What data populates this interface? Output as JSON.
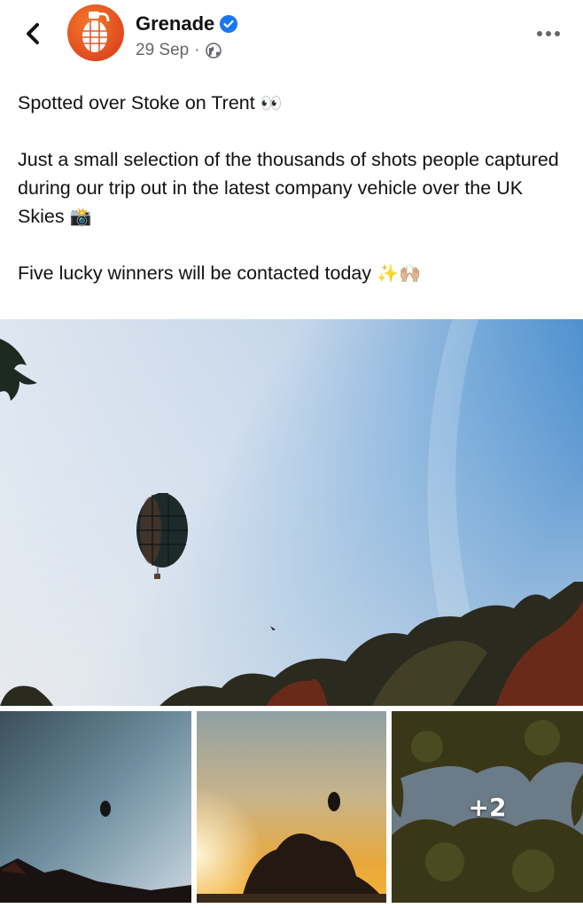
{
  "post": {
    "page_name": "Grenade",
    "date": "29 Sep",
    "separator": "·",
    "text": {
      "line1": "Spotted over Stoke on Trent",
      "line1_emoji": "👀",
      "para2": "Just a small selection of the thousands of shots people captured during our trip out in the latest company vehicle over the UK Skies",
      "para2_emoji": "📸",
      "para3": "Five lucky winners will be contacted today",
      "para3_emoji": "✨🙌🏼"
    }
  },
  "gallery": {
    "extra_count_label": "+2"
  },
  "icons": {
    "back": "chevron-left-icon",
    "verified": "verified-badge-icon",
    "audience": "globe-icon",
    "more": "more-dots-icon"
  },
  "colors": {
    "verified_blue": "#1877f2",
    "brand_orange": "#e8582a",
    "meta_gray": "#65676b"
  }
}
